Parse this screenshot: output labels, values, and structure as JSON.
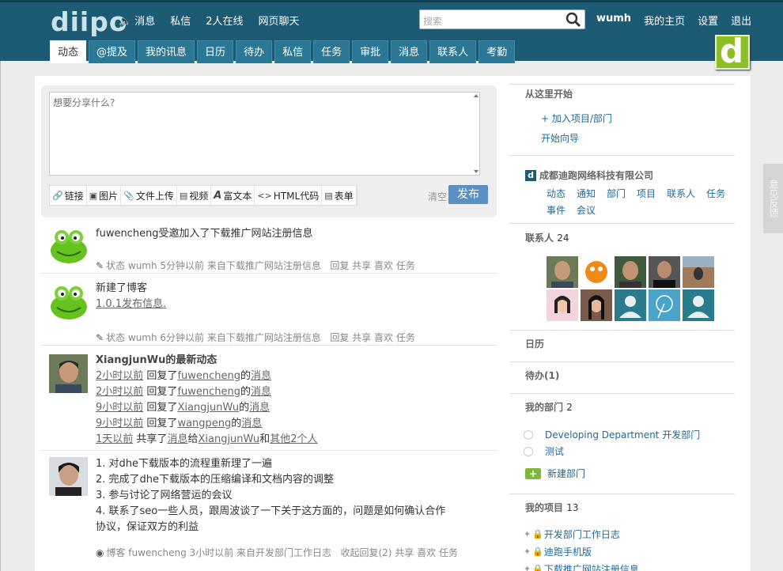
{
  "header": {
    "logo": "diipo",
    "nav": [
      {
        "label": "消息",
        "icon": "speaker-icon"
      },
      {
        "label": "私信"
      },
      {
        "label": "2人在线"
      },
      {
        "label": "网页聊天"
      }
    ],
    "search_placeholder": "搜索",
    "user": {
      "name": "wumh",
      "home": "我的主页",
      "settings": "设置",
      "logout": "退出"
    },
    "tabs": [
      "动态",
      "@提及",
      "我的讯息",
      "日历",
      "待办",
      "私信",
      "任务",
      "审批",
      "消息",
      "联系人",
      "考勤"
    ],
    "active_tab": "动态",
    "badge_letter": "d"
  },
  "composer": {
    "placeholder": "想要分享什么?",
    "tools": [
      {
        "label": "链接",
        "icon": "link-icon"
      },
      {
        "label": "图片",
        "icon": "image-icon"
      },
      {
        "label": "文件上传",
        "icon": "attach-icon"
      },
      {
        "label": "视频",
        "icon": "video-icon"
      },
      {
        "label": "富文本",
        "icon": "richtext-icon"
      },
      {
        "label": "HTML代码",
        "icon": "code-icon"
      },
      {
        "label": "表单",
        "icon": "form-icon"
      }
    ],
    "clear": "清空",
    "publish": "发布"
  },
  "feed": {
    "item1": {
      "text": "fuwencheng受邀加入了下载推广网站注册信息",
      "meta": "状态 wumh 5分钟以前 来自下载推广网站注册信息",
      "actions": [
        "回复",
        "共享",
        "喜欢",
        "任务"
      ]
    },
    "item2": {
      "text": "新建了博客",
      "link": "1.0.1发布信息.",
      "meta": "状态 wumh 6分钟以前 来自下载推广网站注册信息",
      "actions": [
        "回复",
        "共享",
        "喜欢",
        "任务"
      ]
    },
    "item3": {
      "title": "XiangjunWu的最新动态",
      "rows": [
        {
          "time": "2小时以前",
          "verb": "回复了",
          "who": "fuwencheng",
          "of": "的",
          "obj": "消息"
        },
        {
          "time": "2小时以前",
          "verb": "回复了",
          "who": "fuwencheng",
          "of": "的",
          "obj": "消息"
        },
        {
          "time": "9小时以前",
          "verb": "回复了",
          "who": "XiangjunWu",
          "of": "的",
          "obj": "消息"
        },
        {
          "time": "9小时以前",
          "verb": "回复了",
          "who": "wangpeng",
          "of": "的",
          "obj": "消息"
        }
      ],
      "last": {
        "time": "1天以前",
        "verb": "共享了",
        "obj": "消息",
        "give": "给",
        "who": "XiangjunWu",
        "and": "和",
        "others": "其他2个人"
      }
    },
    "item4": {
      "lines": [
        "1. 对dhe下载版本的流程重新理了一遍",
        "2. 完成了dhe下载版本的压缩编译和文档内容的调整",
        "3. 参与讨论了网络营运的会议",
        "4. 联系了seo一些人员，跟周波谈了一下关于这方面的，问题是如何确认合作",
        "协议，保证双方的利益"
      ],
      "meta": "博客 fuwencheng 3小时以前 来自开发部门工作日志",
      "actions": [
        "收起回复(2)",
        "共享",
        "喜欢",
        "任务"
      ]
    }
  },
  "sidebar": {
    "start": {
      "title": "从这里开始",
      "links": [
        "+ 加入项目/部门",
        "开始向导"
      ]
    },
    "company": {
      "name": "成都迪跑网络科技有限公司",
      "links": [
        "动态",
        "通知",
        "部门",
        "项目",
        "联系人",
        "任务",
        "事件",
        "会议"
      ]
    },
    "contacts": {
      "title": "联系人",
      "count": "24"
    },
    "calendar": {
      "title": "日历"
    },
    "todo": {
      "title": "待办(1)"
    },
    "depts": {
      "title": "我的部门",
      "count": "2",
      "items": [
        "Developing Department 开发部门",
        "测试"
      ],
      "new": "新建部门"
    },
    "projects": {
      "title": "我的项目",
      "count": "13",
      "items": [
        "开发部门工作日志",
        "迪跑手机版",
        "下载推广网站注册信息"
      ]
    }
  },
  "feedback": "意见反馈",
  "colors": {
    "header": "#1d5a74",
    "tab": "#2b7796",
    "accent": "#5b91c2",
    "badge": "#8cbf26",
    "link": "#21689a"
  }
}
